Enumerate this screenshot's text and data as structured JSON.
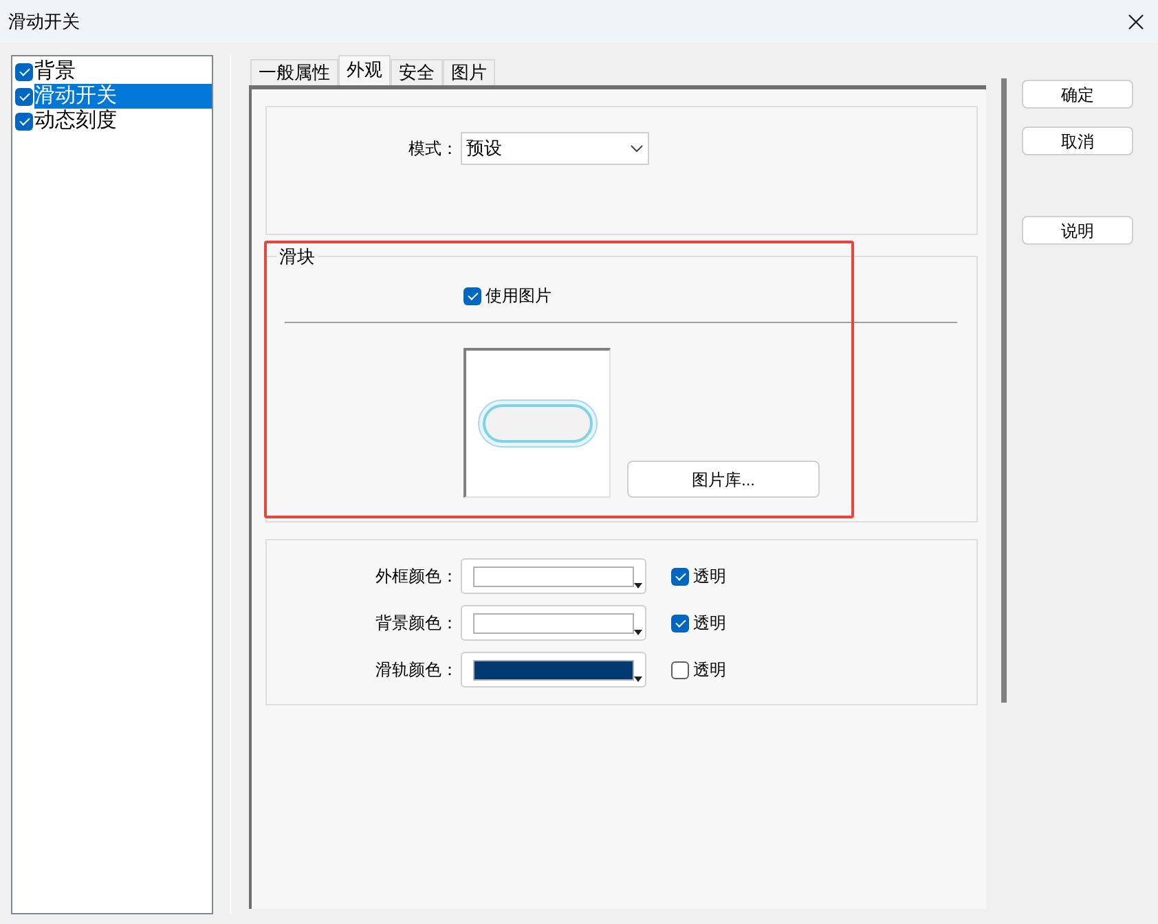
{
  "window": {
    "title": "滑动开关"
  },
  "tree": {
    "items": [
      {
        "label": "背景",
        "checked": true,
        "selected": false
      },
      {
        "label": "滑动开关",
        "checked": true,
        "selected": true
      },
      {
        "label": "动态刻度",
        "checked": true,
        "selected": false
      }
    ]
  },
  "tabs": [
    {
      "label": "一般属性",
      "selected": false
    },
    {
      "label": "外观",
      "selected": true
    },
    {
      "label": "安全",
      "selected": false
    },
    {
      "label": "图片",
      "selected": false
    }
  ],
  "mode": {
    "label": "模式：",
    "value": "预设"
  },
  "slider_group": {
    "title": "滑块",
    "use_image": {
      "label": "使用图片",
      "checked": true
    },
    "library_button": "图片库..."
  },
  "colors": [
    {
      "label": "外框颜色：",
      "color": "#ffffff",
      "transparent": {
        "label": "透明",
        "checked": true
      }
    },
    {
      "label": "背景颜色：",
      "color": "#ffffff",
      "transparent": {
        "label": "透明",
        "checked": true
      }
    },
    {
      "label": "滑轨颜色：",
      "color": "#003a70",
      "transparent": {
        "label": "透明",
        "checked": false
      }
    }
  ],
  "buttons": [
    {
      "label": "确定"
    },
    {
      "label": "取消"
    },
    {
      "label": "说明"
    }
  ]
}
